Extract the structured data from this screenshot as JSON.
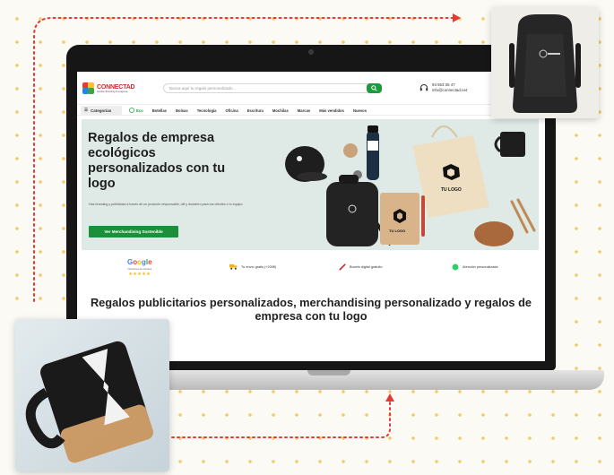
{
  "site": {
    "brand": "CONNECTAD",
    "tagline": "Gestión Branding & Imágenes",
    "search_placeholder": "Busca aquí tu regalo personalizado...",
    "phone": "93 553 35 47",
    "email": "info@connectad.net"
  },
  "nav": {
    "categories_label": "Categorías",
    "items": [
      "Eco",
      "Botellas",
      "Bolsas",
      "Tecnología",
      "Oficina",
      "Escritura",
      "Mochilas",
      "Marcas",
      "Más vendidos",
      "Nuevos"
    ]
  },
  "hero": {
    "title": "Regalos de empresa ecológicos personalizados con tu logo",
    "subtitle": "Haz branding y publicidad a través de un producto responsable, útil y duradero para tus clientes o tu equipo.",
    "cta": "Ver Merchandising Sostenible",
    "product_logo_text": "TU LOGO"
  },
  "trust": {
    "google_label": "Google",
    "google_sub": "Opiniones de clientes",
    "stars": "★★★★★",
    "items": [
      "Tu envío gratis (+200€)",
      "Boceto digital gratuito",
      "Atención personalizada"
    ]
  },
  "headline": "Regalos publicitarios personalizados, merchandising personalizado y regalos de empresa con tu logo",
  "colors": {
    "brand_red": "#cc2b2b",
    "green": "#1c9b3c",
    "hero_bg": "#dfe9e6",
    "connector": "#e53935",
    "dots": "#f4c96a"
  },
  "icons": [
    "search-icon",
    "headset-icon",
    "menu-icon",
    "leaf-icon",
    "truck-icon",
    "pencil-icon",
    "whatsapp-icon"
  ]
}
